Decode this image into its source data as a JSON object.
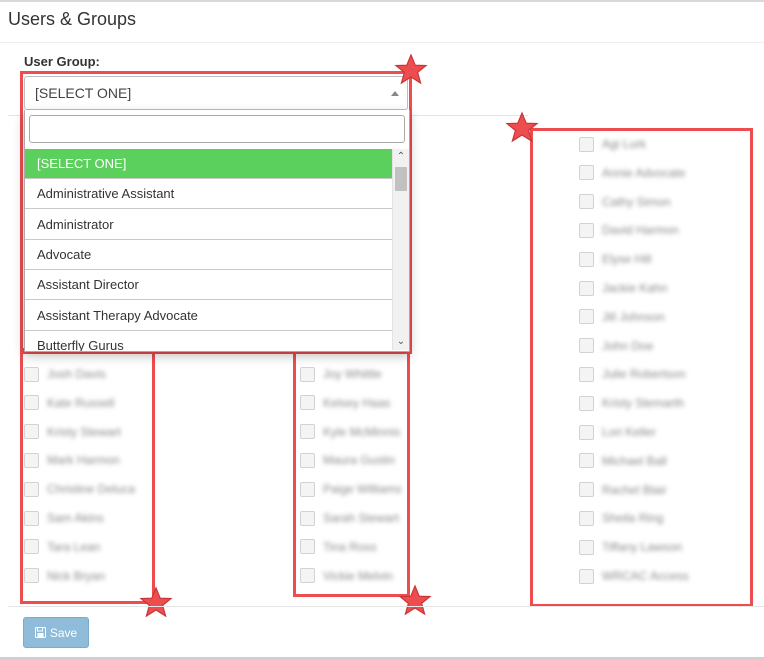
{
  "page": {
    "title": "Users & Groups"
  },
  "form": {
    "user_group_label": "User Group:",
    "save_label": "Save"
  },
  "select": {
    "value": "[SELECT ONE]",
    "search_value": "",
    "options": [
      {
        "label": "[SELECT ONE]",
        "selected": true
      },
      {
        "label": "Administrative Assistant",
        "selected": false
      },
      {
        "label": "Administrator",
        "selected": false
      },
      {
        "label": "Advocate",
        "selected": false
      },
      {
        "label": "Assistant Director",
        "selected": false
      },
      {
        "label": "Assistant Therapy Advocate",
        "selected": false
      },
      {
        "label": "Butterfly Gurus",
        "selected": false
      }
    ]
  },
  "columns": [
    {
      "name": "left",
      "users": [
        "Josh Davis",
        "Kate Russell",
        "Kristy Stewart",
        "Mark Harmon",
        "Christine Deluca",
        "Sam Akins",
        "Tara Lean",
        "Nick Bryan"
      ]
    },
    {
      "name": "middle",
      "users": [
        "Joy Whittle",
        "Kelsey Haas",
        "Kyle McMinnis",
        "Maura Gustin",
        "Paige Williams",
        "Sarah Stewart",
        "Tina Ross",
        "Vickie Melvin"
      ]
    },
    {
      "name": "right",
      "users": [
        "Agi Lurk",
        "Annie Advocate",
        "Cathy Simon",
        "David Harmon",
        "Elyse Hill",
        "Jackie Kahn",
        "Jill Johnson",
        "John Doe",
        "Julie Robertson",
        "Kristy Stemarth",
        "Lori Keller",
        "Michael Ball",
        "Rachel Blair",
        "Sheila Ring",
        "Tiffany Lawson",
        "WRCAC Access"
      ]
    }
  ],
  "colors": {
    "annotation": "#ee4d4f",
    "selected_option": "#5cd05c",
    "save_button": "#8fbcd8"
  },
  "icons": {
    "annotation_marker": "star-icon",
    "save": "floppy-disk-icon",
    "select_toggle": "caret-up-icon"
  }
}
